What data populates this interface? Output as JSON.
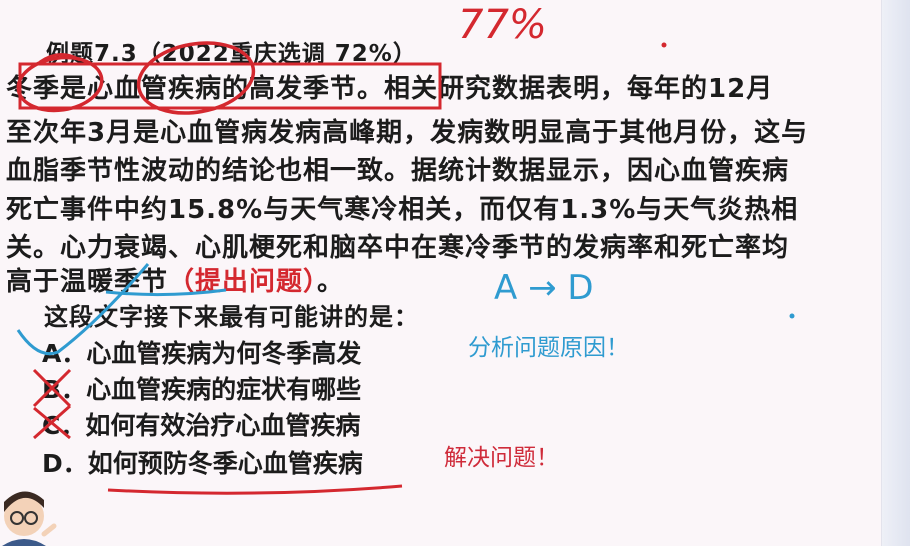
{
  "title": "例题7.3（2022重庆选调 72%）",
  "handwritten_top": "77%",
  "passage": {
    "first_sentence": "冬季是心血管疾病的高发季节。",
    "line1_rest": "相关研究数据表明，每年的12月",
    "line2": "至次年3月是心血管病发病高峰期，发病数明显高于其他月份，这与",
    "line3": "血脂季节性波动的结论也相一致。据统计数据显示，因心血管疾病",
    "line4": "死亡事件中约15.8%与天气寒冷相关，而仅有1.3%与天气炎热相",
    "line5": "关。心力衰竭、心肌梗死和脑卒中在寒冷季节的发病率和死亡率均",
    "line6_start": "高于温暖季节",
    "line6_tag": "（提出问题）",
    "line6_end": "。"
  },
  "question": "这段文字接下来最有可能讲的是：",
  "handwritten_arrow": "A → D",
  "options": [
    {
      "letter": "A．",
      "text": "心血管疾病为何冬季高发"
    },
    {
      "letter": "B．",
      "text": "心血管疾病的症状有哪些"
    },
    {
      "letter": "C．",
      "text": "如何有效治疗心血管疾病"
    },
    {
      "letter": "D．",
      "text": "如何预防冬季心血管疾病"
    }
  ],
  "note_a": "分析问题原因！",
  "note_d": "解决问题！",
  "colors": {
    "annotation_red": "#d4282f",
    "annotation_blue": "#2f9bd0",
    "background": "#fbf6f9"
  }
}
